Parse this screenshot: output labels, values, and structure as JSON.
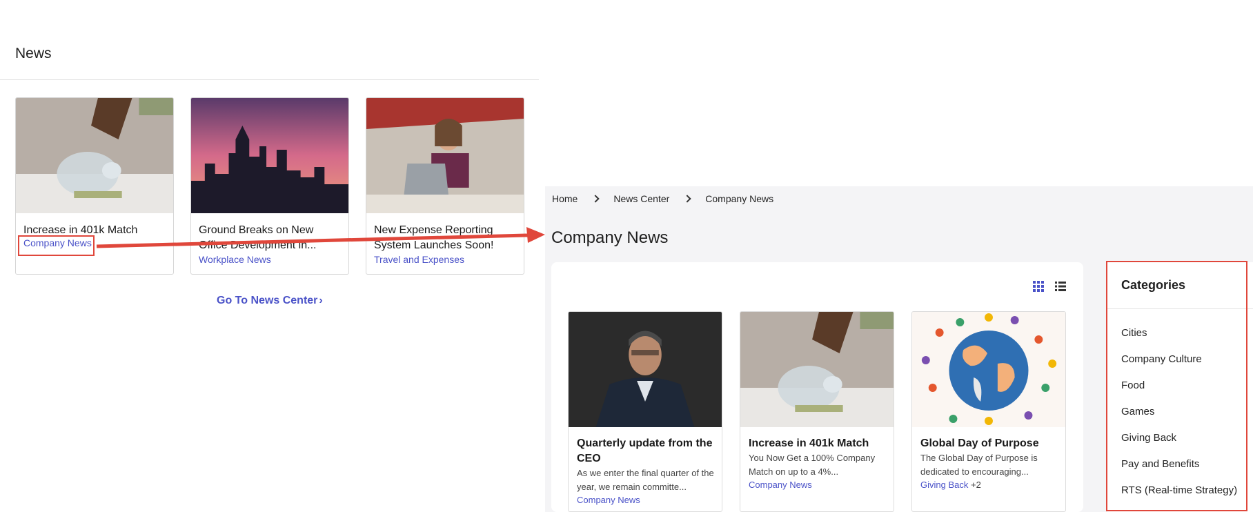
{
  "left": {
    "title": "News",
    "cards": [
      {
        "title": "Increase in 401k Match",
        "category": "Company News"
      },
      {
        "title": "Ground Breaks on New Office Development in...",
        "category": "Workplace News"
      },
      {
        "title": "New Expense Reporting System Launches Soon!",
        "category": "Travel and Expenses"
      }
    ],
    "go_link": "Go To News Center"
  },
  "right": {
    "breadcrumb": [
      "Home",
      "News Center",
      "Company News"
    ],
    "title": "Company News",
    "cards": [
      {
        "title": "Quarterly update from the CEO",
        "desc": "As we enter the final quarter of the year, we remain committe...",
        "category": "Company News"
      },
      {
        "title": "Increase in 401k Match",
        "desc": "You Now Get a 100% Company Match on up to a 4%...",
        "category": "Company News"
      },
      {
        "title": "Global Day of Purpose",
        "desc": "The Global Day of Purpose is dedicated to encouraging...",
        "category": "Giving Back",
        "extra": "+2"
      }
    ],
    "categories_title": "Categories",
    "categories": [
      "Cities",
      "Company Culture",
      "Food",
      "Games",
      "Giving Back",
      "Pay and Benefits",
      "RTS (Real-time Strategy)"
    ]
  },
  "icons": {
    "grid": "grid-view-icon",
    "list": "list-view-icon",
    "arrow": "annotation-arrow-icon"
  },
  "colors": {
    "accent": "#4a52c8",
    "annotation": "#e0473b",
    "panel_bg": "#f4f4f6"
  }
}
